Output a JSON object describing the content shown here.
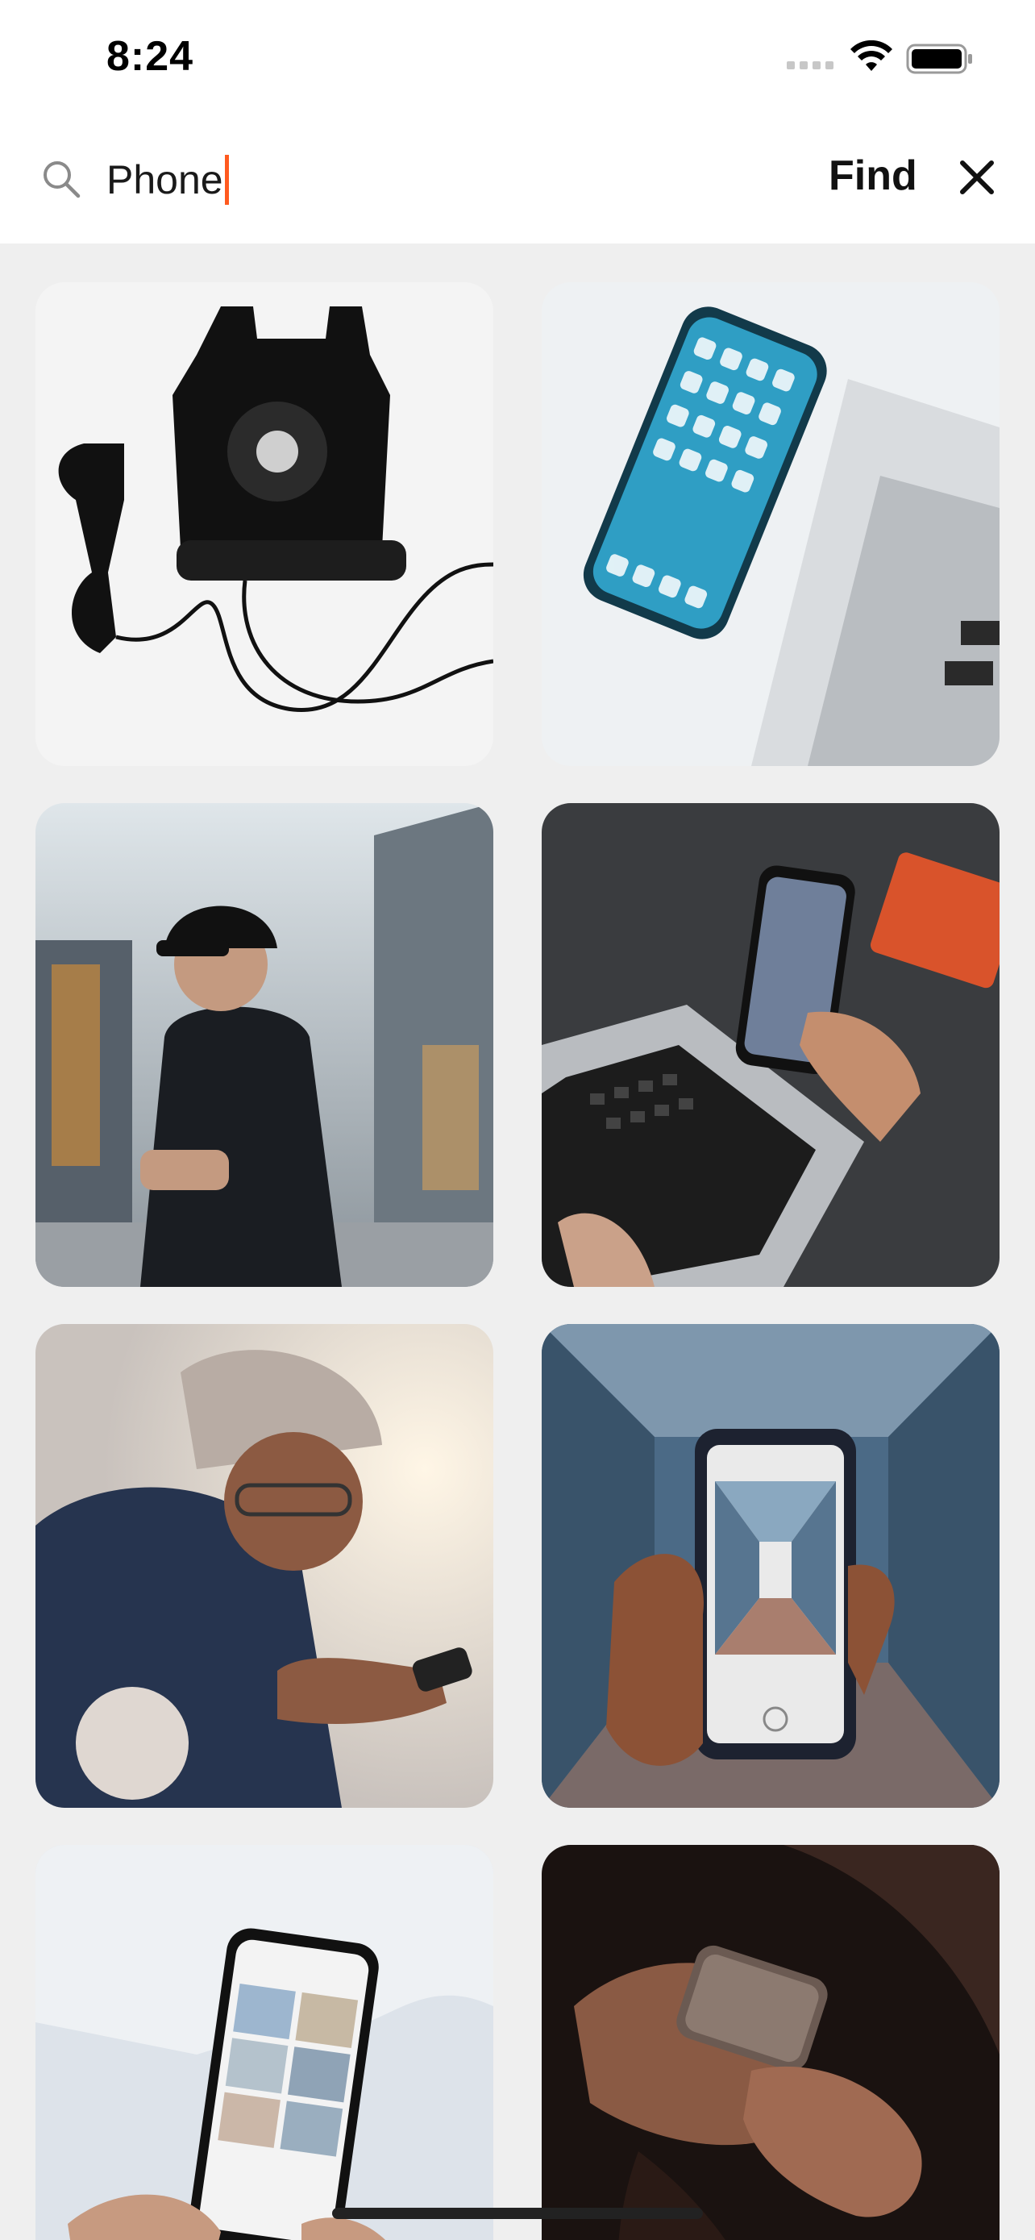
{
  "status_bar": {
    "time": "8:24",
    "icons": [
      "signal-dots-icon",
      "wifi-icon",
      "battery-icon"
    ]
  },
  "search": {
    "query": "Phone",
    "find_label": "Find",
    "search_icon": "magnifier",
    "close_icon": "x",
    "caret_color": "#ff5a1f"
  },
  "results": [
    {
      "subject": "black-rotary-telephone"
    },
    {
      "subject": "smartphone-on-desk-with-laptop"
    },
    {
      "subject": "man-in-cap-looking-at-phone"
    },
    {
      "subject": "hands-holding-phone-over-laptop"
    },
    {
      "subject": "smiling-person-with-beanie-texting"
    },
    {
      "subject": "hand-holding-phone-in-corridor"
    },
    {
      "subject": "hands-holding-phone-with-photos"
    },
    {
      "subject": "hands-holding-phone-dark-background"
    }
  ],
  "colors": {
    "grid_background": "#efefef",
    "text": "#111111",
    "accent": "#ff5a1f"
  }
}
